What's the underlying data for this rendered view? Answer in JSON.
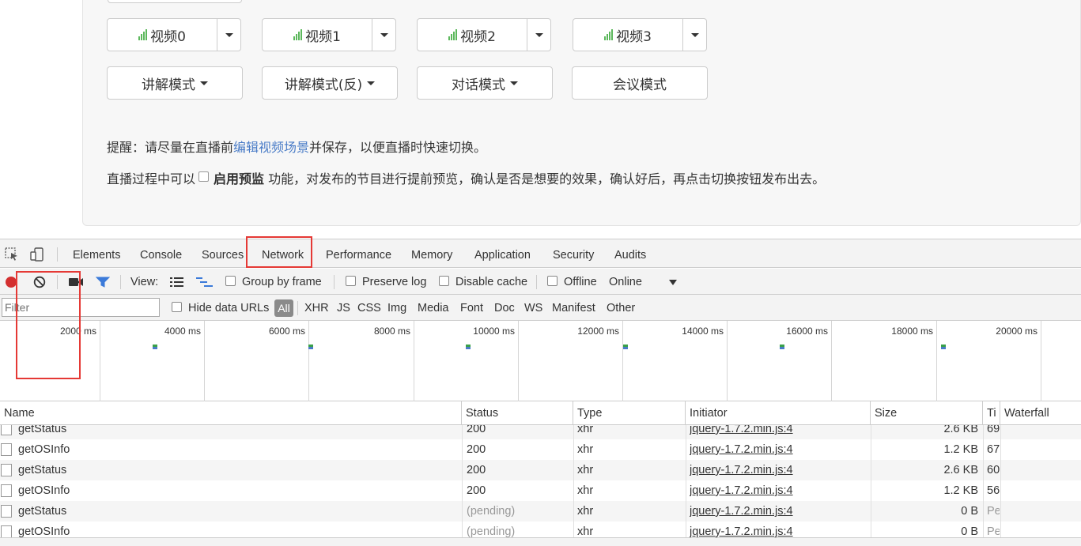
{
  "page": {
    "video_buttons": [
      {
        "label": "视频0"
      },
      {
        "label": "视频1"
      },
      {
        "label": "视频2"
      },
      {
        "label": "视频3"
      }
    ],
    "mode_buttons": [
      {
        "label": "讲解模式",
        "has_caret": true
      },
      {
        "label": "讲解模式(反)",
        "has_caret": true
      },
      {
        "label": "对话模式",
        "has_caret": true
      },
      {
        "label": "会议模式",
        "has_caret": false
      }
    ],
    "tip1": {
      "prefix": "提醒：请尽量在直播前",
      "link": "编辑视频场景",
      "suffix": "并保存，以便直播时快速切换。"
    },
    "tip2": {
      "prefix": "直播过程中可以",
      "bold": "启用预监",
      "suffix": " 功能，对发布的节目进行提前预览，确认是否是想要的效果，确认好后，再点击切换按钮发布出去。"
    },
    "colors": {
      "link": "#4a7cc7",
      "signal": "#5cb85c",
      "highlight": "#e53935"
    }
  },
  "devtools": {
    "tabs": [
      "Elements",
      "Console",
      "Sources",
      "Network",
      "Performance",
      "Memory",
      "Application",
      "Security",
      "Audits"
    ],
    "active_tab": "Network",
    "toolbar": {
      "view_label": "View:",
      "group_by_frame": "Group by frame",
      "preserve_log": "Preserve log",
      "disable_cache": "Disable cache",
      "offline": "Offline",
      "throttle": "Online"
    },
    "filter": {
      "placeholder": "Filter",
      "hide_data_urls": "Hide data URLs",
      "types": [
        "All",
        "XHR",
        "JS",
        "CSS",
        "Img",
        "Media",
        "Font",
        "Doc",
        "WS",
        "Manifest",
        "Other"
      ]
    },
    "overview_ticks": [
      "2000 ms",
      "4000 ms",
      "6000 ms",
      "8000 ms",
      "10000 ms",
      "12000 ms",
      "14000 ms",
      "16000 ms",
      "18000 ms",
      "20000 ms"
    ],
    "columns": [
      "Name",
      "Status",
      "Type",
      "Initiator",
      "Size",
      "Ti",
      "Waterfall"
    ],
    "rows": [
      {
        "name": "getStatus",
        "status": "200",
        "type": "xhr",
        "initiator": "jquery-1.7.2.min.js:4",
        "size": "2.6 KB",
        "time": "69"
      },
      {
        "name": "getOSInfo",
        "status": "200",
        "type": "xhr",
        "initiator": "jquery-1.7.2.min.js:4",
        "size": "1.2 KB",
        "time": "67"
      },
      {
        "name": "getStatus",
        "status": "200",
        "type": "xhr",
        "initiator": "jquery-1.7.2.min.js:4",
        "size": "2.6 KB",
        "time": "60"
      },
      {
        "name": "getOSInfo",
        "status": "200",
        "type": "xhr",
        "initiator": "jquery-1.7.2.min.js:4",
        "size": "1.2 KB",
        "time": "56"
      },
      {
        "name": "getStatus",
        "status": "(pending)",
        "type": "xhr",
        "initiator": "jquery-1.7.2.min.js:4",
        "size": "0 B",
        "time": "Pe"
      },
      {
        "name": "getOSInfo",
        "status": "(pending)",
        "type": "xhr",
        "initiator": "jquery-1.7.2.min.js:4",
        "size": "0 B",
        "time": "Pe"
      }
    ]
  }
}
